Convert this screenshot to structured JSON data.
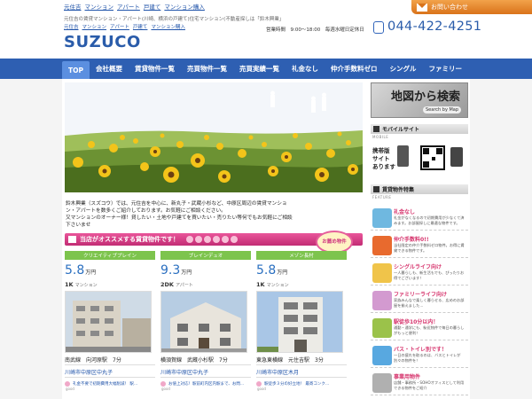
{
  "top_links": [
    "元住吉",
    "マンション",
    "アパート",
    "戸建て",
    "マンション購入"
  ],
  "contact_label": "お問い合わせ",
  "tagline": "元住吉の賃貸マンション・アパート(川崎、横浜の戸建て)住宅マンション(不動産探しは「鈴木興業」",
  "sub_links": [
    "元住吉",
    "マンション",
    "アパート",
    "戸建て",
    "マンション購入"
  ],
  "logo": "SUZUCO",
  "hours": "営業時間　9:00～18:00　毎週水曜日定休日",
  "phone": "044-422-4251",
  "nav": {
    "items": [
      "TOP",
      "会社概要",
      "賃貸物件一覧",
      "売買物件一覧",
      "売買実績一覧",
      "礼金なし",
      "仲介手数料ゼロ",
      "シングル",
      "ファミリー"
    ],
    "active": "TOP"
  },
  "intro": {
    "line1": "鈴木興業（スズコウ）では、元住吉を中心に、新丸子・武蔵小杉など、中原区周辺の賃貸マンショ",
    "line2": "ン・アパートを数多くご紹介しております。お気軽にご相談ください。",
    "line3": "又マンションのオーナー様！貸したい・土地や戸建てを買いたい・売りたい等何でもお気軽にご相談",
    "line4": "下さいませ"
  },
  "banner": {
    "text": "当店がオススメする賃貸物件です！",
    "badge": "お薦め物件"
  },
  "listings": [
    {
      "tag": "クリエイティブプレイン",
      "price": "5.8",
      "unit": "万円",
      "layout": "1K",
      "kind": "マンション",
      "station": "南武線　向河原駅　7分",
      "address": "川崎市中原区中丸子",
      "note": "礼金不要で初期費用大幅削減！ 駅...",
      "good": "good"
    },
    {
      "tag": "ブレインデュオ",
      "price": "9.3",
      "unit": "万円",
      "layout": "2DK",
      "kind": "アパート",
      "station": "横須賀線　武蔵小杉駅　7分",
      "address": "川崎市中原区中丸子",
      "note": "お値上対応！駅前町内区内駅まで、お問...",
      "good": "good"
    },
    {
      "tag": "メゾン長村",
      "price": "5.8",
      "unit": "万円",
      "layout": "1K",
      "kind": "マンション",
      "station": "東急東横線　元住吉駅　3分",
      "address": "川崎市中原区木月",
      "note": "駅徒歩３分の好立地！ 最寄コンク...",
      "good": "good"
    }
  ],
  "sidebar": {
    "map_title": "地図から検索",
    "map_sub": "Search by Map",
    "mobile_head": "モバイルサイト",
    "mobile_sub": "MOBILE",
    "mobile_text1": "携帯版",
    "mobile_text2": "サイト",
    "mobile_text3": "あります",
    "features_head": "賃貸物件特集",
    "features_sub": "FEATURE",
    "features": [
      {
        "title": "礼金なし",
        "desc": "礼金がなくなるので初期費用が少なくて済みます。お部屋探しに最適な物件です。",
        "color": "#6fb8e0"
      },
      {
        "title": "仲介手数料0!!",
        "desc": "当社限定の仲介手数料ゼロ物件。お得に賃貸できる物件です。",
        "color": "#e86a2e"
      },
      {
        "title": "シングルライフ向け",
        "desc": "一人暮らしも、新生活もでも、ぴったりお得でございます！",
        "color": "#f0c44a"
      },
      {
        "title": "ファミリーライフ向け",
        "desc": "家族みんなで楽しく暮らせる、広めのお部屋を揃えました...",
        "color": "#d39ad0"
      },
      {
        "title": "駅徒歩10分以内！",
        "desc": "通勤・通学にも、駅近物件で毎日の暮らしがもっと便利！",
        "color": "#9bc24a"
      },
      {
        "title": "バス・トイレ別です！",
        "desc": "一日の疲れを取るのは、バスとトイレが別々の物件を！",
        "color": "#58a8e0"
      },
      {
        "title": "事業用物件",
        "desc": "店舗・事務所・SOHOオフィスとして利用できる物件をご紹介",
        "color": "#b0b0b0"
      }
    ]
  },
  "colors": {
    "nav": "#2e5fb2",
    "accent_green": "#7dc44d",
    "price_blue": "#2a6fc0",
    "banner_pink": "#d43d84"
  }
}
